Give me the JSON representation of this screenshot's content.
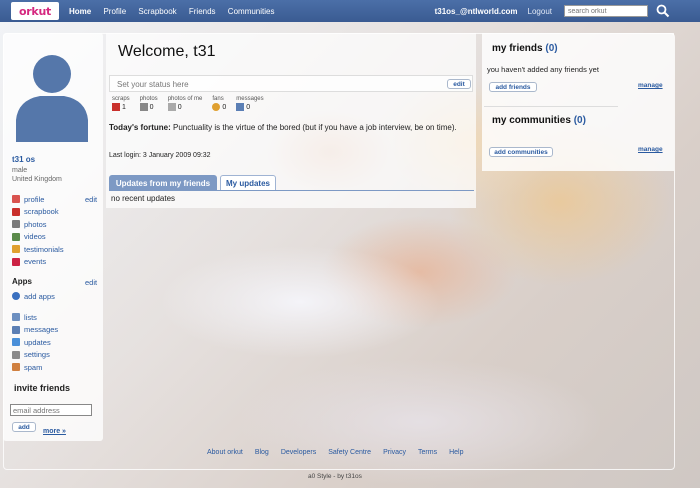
{
  "topbar": {
    "logo": "orkut",
    "nav": [
      "Home",
      "Profile",
      "Scrapbook",
      "Friends",
      "Communities"
    ],
    "user_email": "t31os_@ntlworld.com",
    "logout": "Logout",
    "search_placeholder": "search orkut"
  },
  "profile": {
    "name": "t31 os",
    "gender": "male",
    "country": "United Kingdom",
    "edit": "edit",
    "menu": [
      "profile",
      "scrapbook",
      "photos",
      "videos",
      "testimonials",
      "events"
    ]
  },
  "apps": {
    "title": "Apps",
    "edit": "edit",
    "add_apps": "add apps",
    "items": [
      "lists",
      "messages",
      "updates",
      "settings",
      "spam"
    ]
  },
  "invite": {
    "title": "invite friends",
    "email_placeholder": "email address",
    "add_button": "add",
    "more_link": "more »"
  },
  "main": {
    "welcome": "Welcome, t31",
    "status_placeholder": "Set your status here",
    "status_edit": "edit",
    "stats": [
      {
        "label": "scraps",
        "value": "1"
      },
      {
        "label": "photos",
        "value": "0"
      },
      {
        "label": "photos of me",
        "value": "0"
      },
      {
        "label": "fans",
        "value": "0"
      },
      {
        "label": "messages",
        "value": "0"
      }
    ],
    "fortune_label": "Today's fortune:",
    "fortune_text": "Punctuality is the virtue of the bored (but if you have a job interview, be on time).",
    "last_login": "Last login: 3 January 2009 09:32",
    "tabs": [
      "Updates from my friends",
      "My updates"
    ],
    "no_updates": "no recent updates"
  },
  "sidebar_right": {
    "friends_title": "my friends",
    "friends_count": "(0)",
    "friends_empty": "you haven't added any friends yet",
    "add_friends": "add friends",
    "manage": "manage",
    "communities_title": "my communities",
    "communities_count": "(0)",
    "add_communities": "add communities",
    "manage2": "manage"
  },
  "footer": {
    "links": [
      "About orkut",
      "Blog",
      "Developers",
      "Safety Centre",
      "Privacy",
      "Terms",
      "Help"
    ],
    "credit": "a0 Style - by t31os"
  },
  "colors": {
    "topbar": "#3f63a0",
    "link": "#2a5aa0",
    "logo": "#d5277f",
    "tab_active": "#7d99c4"
  }
}
